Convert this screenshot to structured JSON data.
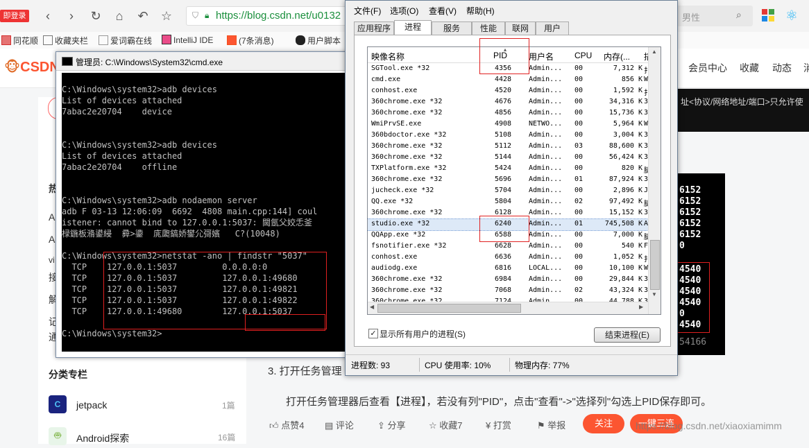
{
  "browser": {
    "url": "https://blog.csdn.net/u0132",
    "search_placeholder": "男性",
    "badge": "即登录",
    "bookmarks": [
      "同花顺",
      "收藏夹栏",
      "爱词霸在线",
      "IntelliJ IDE",
      "(7条消息)",
      "用户脚本"
    ]
  },
  "csdn": {
    "logo": "CSDN",
    "header_links": [
      "会员中心",
      "收藏",
      "动态",
      "消"
    ],
    "article_banner": "址<协议/网络地址/端口>只允许使",
    "sidebar": {
      "letters": [
        "热",
        "A",
        "A",
        "vi",
        "接",
        "解",
        "记",
        "通"
      ],
      "column_title": "分类专栏",
      "columns": [
        {
          "name": "jetpack",
          "count": "1篇"
        },
        {
          "name": "Android探索",
          "count": "16篇"
        }
      ]
    },
    "step_heading": "3. 打开任务管理",
    "paragraph": "打开任务管理器后查看【进程】，若没有列\"PID\"，点击\"查看\"->\"选择列\"勾选上PID保存即可。",
    "actions": {
      "like": "点赞4",
      "comment": "评论",
      "share": "分享",
      "favorite": "收藏7",
      "reward": "打赏",
      "report": "举报",
      "follow": "关注",
      "one_click": "一键三连"
    },
    "watermark": "https://blog.csdn.net/xiaoxiamimm",
    "right_terminal": [
      "6152",
      "6152",
      "6152",
      "6152",
      "6152",
      "0",
      "4540",
      "4540",
      "4540",
      "4540",
      "0",
      "4540"
    ],
    "right_terminal_tail": "54166"
  },
  "cmd": {
    "title": "管理员: C:\\Windows\\System32\\cmd.exe",
    "lines": [
      "",
      "C:\\Windows\\system32>adb devices",
      "List of devices attached",
      "7abac2e20704    device",
      "",
      "",
      "C:\\Windows\\system32>adb devices",
      "List of devices attached",
      "7abac2e20704    offline",
      "",
      "",
      "C:\\Windows\\system32>adb nodaemon server",
      "adb F 03-13 12:06:09  6692  4808 main.cpp:144] coul",
      "istener: cannot bind to 127.0.0.1:5037: 閫氬父姣忎釜",
      "椂鍦板潃鍙綅  彛>鍌  庣瓟鎬娇鐢尣彁嬪   C?(10048)",
      "",
      "C:\\Windows\\system32>netstat -ano | findstr \"5037\"",
      "  TCP    127.0.0.1:5037         0.0.0.0:0",
      "  TCP    127.0.0.1:5037         127.0.0.1:49680",
      "  TCP    127.0.0.1:5037         127.0.0.1:49821",
      "  TCP    127.0.0.1:5037         127.0.0.1:49822",
      "  TCP    127.0.0.1:49680        127.0.0.1:5037",
      "",
      "C:\\Windows\\system32>"
    ]
  },
  "taskmgr": {
    "menus": [
      "文件(F)",
      "选项(O)",
      "查看(V)",
      "帮助(H)"
    ],
    "tabs": [
      "应用程序",
      "进程",
      "服务",
      "性能",
      "联网",
      "用户"
    ],
    "active_tab": "进程",
    "columns": [
      "映像名称",
      "PID",
      "用户名",
      "CPU",
      "内存(...",
      "描"
    ],
    "rows": [
      [
        "SGTool.exe *32",
        "4356",
        "Admin...",
        "00",
        "7,312 K",
        "扌"
      ],
      [
        "cmd.exe",
        "4428",
        "Admin...",
        "00",
        "856 K",
        "W"
      ],
      [
        "conhost.exe",
        "4520",
        "Admin...",
        "00",
        "1,592 K",
        "扌"
      ],
      [
        "360chrome.exe *32",
        "4676",
        "Admin...",
        "00",
        "34,316 K",
        "3"
      ],
      [
        "360chrome.exe *32",
        "4856",
        "Admin...",
        "00",
        "15,736 K",
        "3"
      ],
      [
        "WmiPrvSE.exe",
        "4908",
        "NETWO...",
        "00",
        "5,964 K",
        "W"
      ],
      [
        "360bdoctor.exe *32",
        "5108",
        "Admin...",
        "00",
        "3,004 K",
        "3"
      ],
      [
        "360chrome.exe *32",
        "5112",
        "Admin...",
        "03",
        "88,600 K",
        "3"
      ],
      [
        "360chrome.exe *32",
        "5144",
        "Admin...",
        "00",
        "56,424 K",
        "3"
      ],
      [
        "TXPlatform.exe *32",
        "5424",
        "Admin...",
        "00",
        "820 K",
        "腿"
      ],
      [
        "360chrome.exe *32",
        "5696",
        "Admin...",
        "01",
        "87,924 K",
        "3"
      ],
      [
        "jucheck.exe *32",
        "5704",
        "Admin...",
        "00",
        "2,896 K",
        "J"
      ],
      [
        "QQ.exe *32",
        "5804",
        "Admin...",
        "02",
        "97,492 K",
        "腿"
      ],
      [
        "360chrome.exe *32",
        "6128",
        "Admin...",
        "00",
        "15,152 K",
        "3"
      ],
      [
        "studio.exe *32",
        "6240",
        "Admin...",
        "01",
        "745,508 K",
        "A"
      ],
      [
        "QQApp.exe *32",
        "6588",
        "Admin...",
        "00",
        "7,000 K",
        "腿"
      ],
      [
        "fsnotifier.exe *32",
        "6628",
        "Admin...",
        "00",
        "540 K",
        "F"
      ],
      [
        "conhost.exe",
        "6636",
        "Admin...",
        "00",
        "1,052 K",
        "扌"
      ],
      [
        "audiodg.exe",
        "6816",
        "LOCAL...",
        "00",
        "10,100 K",
        "W"
      ],
      [
        "360chrome.exe *32",
        "6984",
        "Admin...",
        "00",
        "29,844 K",
        "3"
      ],
      [
        "360chrome.exe *32",
        "7068",
        "Admin...",
        "02",
        "43,324 K",
        "3"
      ],
      [
        "360chrome.exe *32",
        "7124",
        "Admin...",
        "00",
        "44,788 K",
        "3"
      ]
    ],
    "selected_row_index": 14,
    "show_all_users_label": "显示所有用户的进程(S)",
    "end_process_label": "结束进程(E)",
    "status": {
      "process_count": "进程数: 93",
      "cpu": "CPU 使用率: 10%",
      "memory": "物理内存: 77%"
    }
  }
}
